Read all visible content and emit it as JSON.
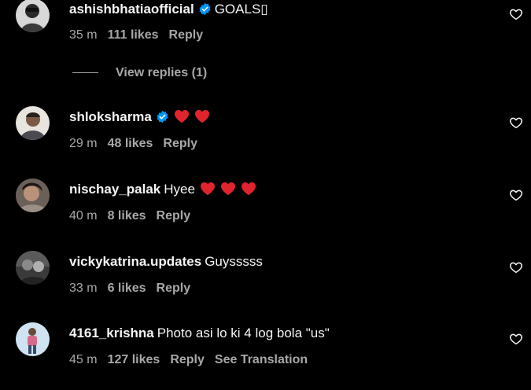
{
  "comments": [
    {
      "username": "ashishbhatiaofficial",
      "verified": true,
      "text": "GOALS▯",
      "hearts": 0,
      "time": "35 m",
      "likes": "111 likes",
      "reply": "Reply",
      "view_replies": "View replies (1)"
    },
    {
      "username": "shloksharma",
      "verified": true,
      "text": "",
      "hearts": 2,
      "time": "29 m",
      "likes": "48 likes",
      "reply": "Reply"
    },
    {
      "username": "nischay_palak",
      "verified": false,
      "text": "Hyee",
      "hearts": 3,
      "time": "40 m",
      "likes": "8 likes",
      "reply": "Reply"
    },
    {
      "username": "vickykatrina.updates",
      "verified": false,
      "text": "Guysssss",
      "hearts": 0,
      "time": "33 m",
      "likes": "6 likes",
      "reply": "Reply"
    },
    {
      "username": "4161_krishna",
      "verified": false,
      "text": "Photo asi lo ki 4 log bola \"us\"",
      "hearts": 0,
      "time": "45 m",
      "likes": "127 likes",
      "reply": "Reply",
      "see_translation": "See Translation"
    }
  ],
  "icons": {
    "like": "heart-outline-icon",
    "verified": "verified-badge-icon",
    "emoji": "red-heart-emoji"
  },
  "colors": {
    "background": "#000000",
    "primary_text": "#f5f5f5",
    "secondary_text": "#a8a8a8",
    "verified_blue": "#0095f6",
    "heart_red": "#e0242e"
  }
}
